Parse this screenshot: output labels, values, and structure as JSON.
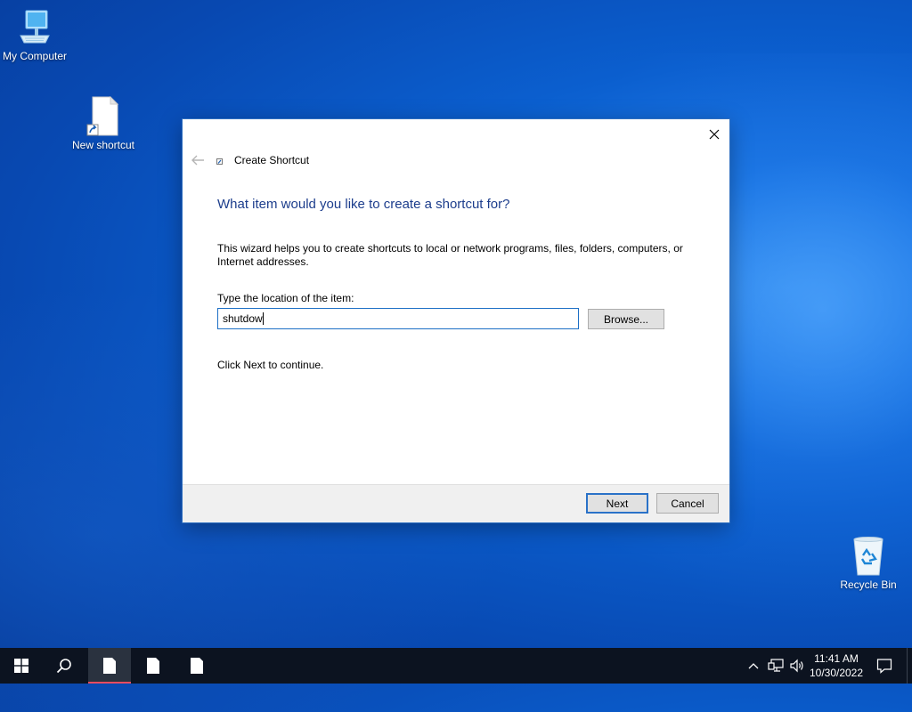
{
  "desktop": {
    "icons": [
      {
        "label": "My Computer",
        "icon": "computer-icon"
      },
      {
        "label": "New shortcut",
        "icon": "shortcut-file-icon"
      },
      {
        "label": "Recycle Bin",
        "icon": "recycle-bin-icon"
      }
    ]
  },
  "dialog": {
    "title": "Create Shortcut",
    "heading": "What item would you like to create a shortcut for?",
    "description": "This wizard helps you to create shortcuts to local or network programs, files, folders, computers, or Internet addresses.",
    "location_label": "Type the location of the item:",
    "location_value": "shutdow",
    "browse_label": "Browse...",
    "hint": "Click Next to continue.",
    "next_label": "Next",
    "cancel_label": "Cancel"
  },
  "taskbar": {
    "pinned": [
      "start-icon",
      "search-icon",
      "file-icon",
      "file-icon",
      "file-icon"
    ],
    "tray": {
      "time": "11:41 AM",
      "date": "10/30/2022"
    }
  },
  "colors": {
    "accent": "#1d6fc6",
    "heading": "#1c3d8c",
    "taskbar": "#0c1320",
    "active_indicator": "#e84b5f"
  }
}
